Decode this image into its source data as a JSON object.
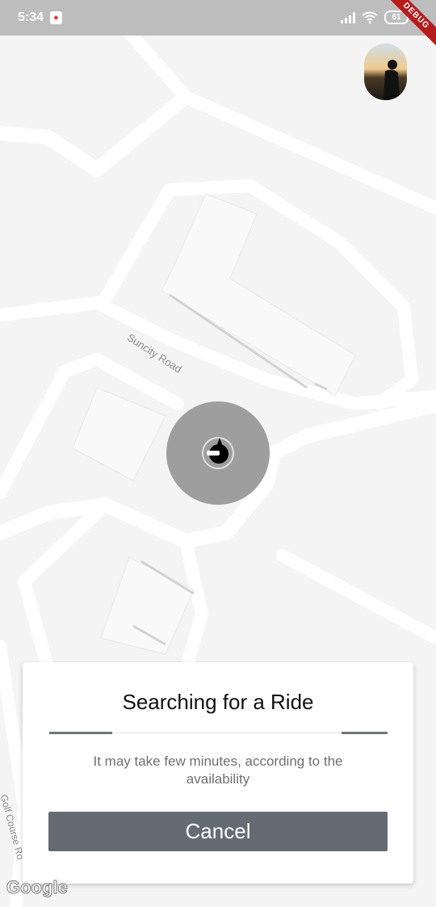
{
  "status_bar": {
    "time": "5:34",
    "battery": "61",
    "debug_banner": "DEBUG",
    "icons": [
      "google-maps-icon",
      "signal-icon",
      "wifi-icon",
      "battery-icon"
    ]
  },
  "map": {
    "road_labels": [
      "Suncity Road",
      "Golf Course Ro"
    ],
    "attribution": "Google"
  },
  "profile": {
    "icon": "avatar"
  },
  "ride_card": {
    "title": "Searching for a Ride",
    "subtitle": "It may take few minutes, according to the availability",
    "cancel_label": "Cancel"
  },
  "colors": {
    "map_bg": "#f4f4f4",
    "road": "#ffffff",
    "pulse": "#9e9e9e",
    "button": "#646b72",
    "progress": "#6d757c"
  }
}
